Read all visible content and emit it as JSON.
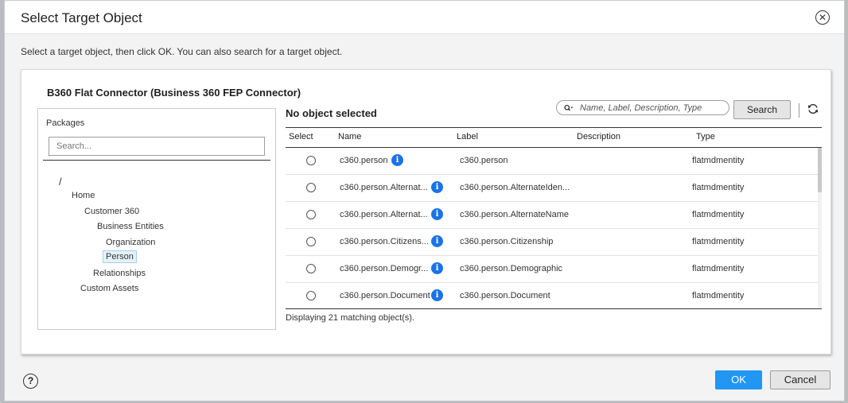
{
  "dialog": {
    "title": "Select Target Object",
    "instruction": "Select a target object, then click OK. You can also search for a target object."
  },
  "connection": {
    "title": "B360 Flat Connector (Business 360 FEP Connector)"
  },
  "packages": {
    "label": "Packages",
    "search_placeholder": "Search...",
    "tree": [
      {
        "label": "/"
      },
      {
        "label": "Home"
      },
      {
        "label": "Customer 360"
      },
      {
        "label": "Business Entities"
      },
      {
        "label": "Organization"
      },
      {
        "label": "Person",
        "selected": true
      },
      {
        "label": "Relationships"
      },
      {
        "label": "Custom Assets"
      }
    ]
  },
  "selection_status": "No object selected",
  "search": {
    "placeholder": "Name, Label, Description, Type",
    "button_label": "Search"
  },
  "table": {
    "columns": [
      "Select",
      "Name",
      "Label",
      "Description",
      "Type"
    ],
    "rows": [
      {
        "name": "c360.person",
        "label": "c360.person",
        "description": "",
        "type": "flatmdmentity"
      },
      {
        "name": "c360.person.Alternat...",
        "label": "c360.person.AlternateIden...",
        "description": "",
        "type": "flatmdmentity"
      },
      {
        "name": "c360.person.Alternat...",
        "label": "c360.person.AlternateName",
        "description": "",
        "type": "flatmdmentity"
      },
      {
        "name": "c360.person.Citizens...",
        "label": "c360.person.Citizenship",
        "description": "",
        "type": "flatmdmentity"
      },
      {
        "name": "c360.person.Demogr...",
        "label": "c360.person.Demographic",
        "description": "",
        "type": "flatmdmentity"
      },
      {
        "name": "c360.person.Document",
        "label": "c360.person.Document",
        "description": "",
        "type": "flatmdmentity"
      }
    ],
    "count_text": "Displaying 21 matching object(s)."
  },
  "footer": {
    "ok_label": "OK",
    "cancel_label": "Cancel"
  },
  "icons": {
    "close": "close-circle-icon",
    "search": "search-icon",
    "refresh": "refresh-icon",
    "info": "info-icon",
    "help": "help-icon"
  },
  "colors": {
    "accent": "#2196f3",
    "info": "#1a73e8",
    "selected_bg": "#e3f2fc"
  }
}
